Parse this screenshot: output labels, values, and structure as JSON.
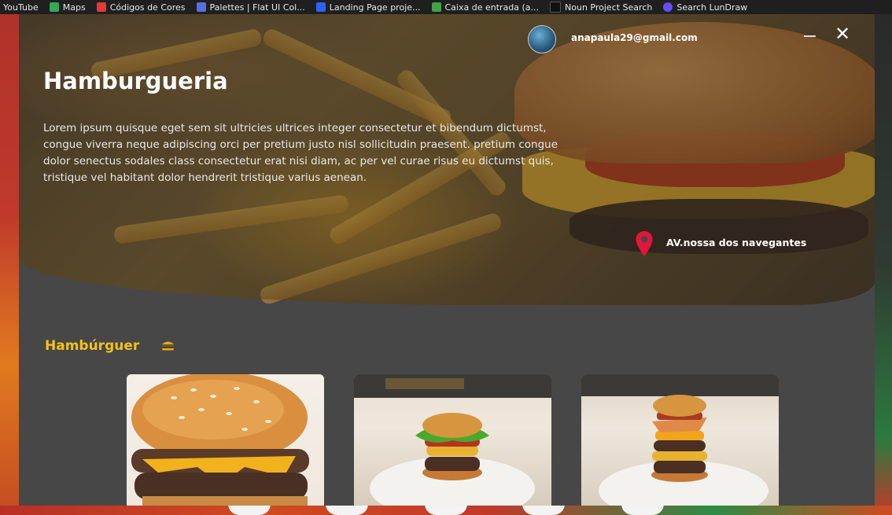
{
  "browser": {
    "bookmarks": [
      {
        "label": "YouTube",
        "color": "#ff0000"
      },
      {
        "label": "Maps",
        "color": "#34a853"
      },
      {
        "label": "Códigos de Cores",
        "color": "#e53935"
      },
      {
        "label": "Palettes | Flat UI Col...",
        "color": "#5b6ee1"
      },
      {
        "label": "Landing Page proje...",
        "color": "#2962ff"
      },
      {
        "label": "Caixa de entrada (a...",
        "color": "#43a047"
      },
      {
        "label": "Noun Project Search",
        "color": "#111111"
      },
      {
        "label": "Search LunDraw",
        "color": "#6a4cff"
      }
    ]
  },
  "header": {
    "user_email": "anapaula29@gmail.com",
    "close_symbol": "✕"
  },
  "hero": {
    "title": "Hamburgueria",
    "description": "Lorem ipsum quisque eget sem sit ultricies ultrices integer consectetur et bibendum dictumst, congue viverra neque adipiscing orci per pretium justo nisl sollicitudin praesent. pretium congue dolor senectus sodales class consectetur erat nisi diam, ac per vel curae risus eu dictumst quis, tristique vel habitant dolor hendrerit tristique varius aenean.",
    "location": "AV.nossa dos navegantes"
  },
  "menu": {
    "section_title": "Hambúrguer"
  },
  "colors": {
    "accent": "#f2c21a",
    "panel": "#474747",
    "pin": "#e5143c"
  }
}
